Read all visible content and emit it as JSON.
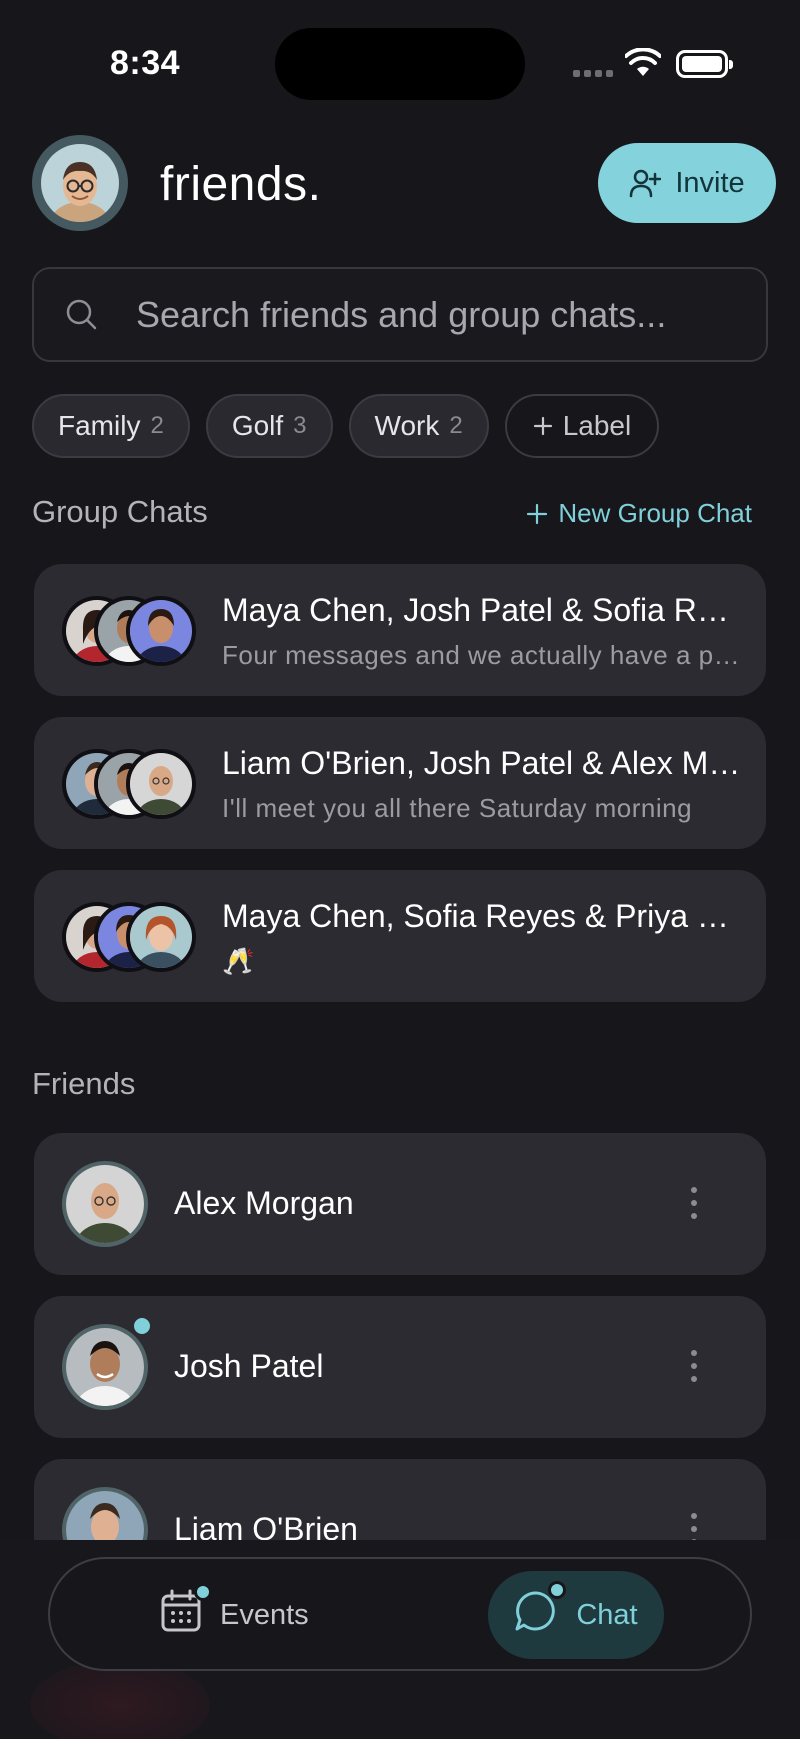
{
  "status_bar": {
    "time": "8:34"
  },
  "header": {
    "title": "friends.",
    "invite_label": "Invite"
  },
  "search": {
    "placeholder": "Search friends and group chats..."
  },
  "labels": [
    {
      "name": "Family",
      "count": "2"
    },
    {
      "name": "Golf",
      "count": "3"
    },
    {
      "name": "Work",
      "count": "2"
    }
  ],
  "add_label": "Label",
  "group_chats": {
    "title": "Group Chats",
    "new_label": "New Group Chat",
    "items": [
      {
        "name": "Maya Chen, Josh Patel & Sofia Reyes",
        "preview": "Four messages and we actually have a plan"
      },
      {
        "name": "Liam O'Brien, Josh Patel & Alex Morgan",
        "preview": "I'll meet you all there Saturday morning"
      },
      {
        "name": "Maya Chen, Sofia Reyes & Priya Shah",
        "preview": "🥂"
      }
    ]
  },
  "friends": {
    "title": "Friends",
    "items": [
      {
        "name": "Alex Morgan"
      },
      {
        "name": "Josh Patel"
      },
      {
        "name": "Liam O'Brien"
      }
    ]
  },
  "tabbar": {
    "events_label": "Events",
    "chat_label": "Chat"
  },
  "colors": {
    "accent": "#84d2dc",
    "background": "#17161b",
    "card": "#2c2b31"
  }
}
